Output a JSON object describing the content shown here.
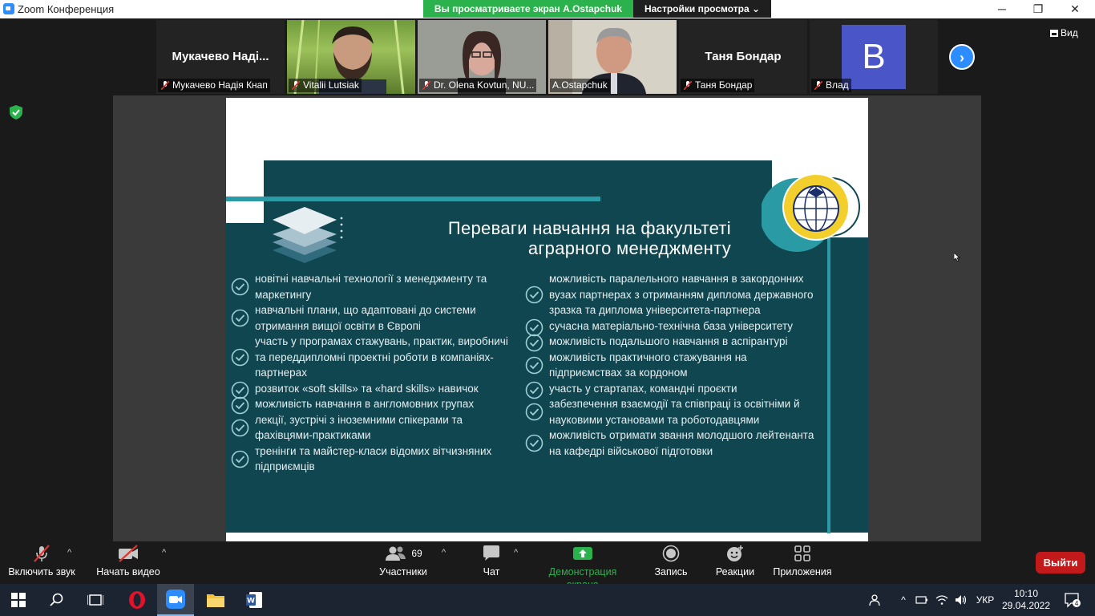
{
  "window": {
    "title": "Zoom Конференция",
    "minimize": "─",
    "restore": "❐",
    "close": "✕"
  },
  "banner": {
    "viewing_text": "Вы просматриваете экран A.Ostapchuk",
    "view_options": "Настройки просмотра ⌄",
    "view_button": "Вид"
  },
  "participants": [
    {
      "big_name": "Мукачево  Наді...",
      "label": "Мукачево Надія Кнап",
      "video": false
    },
    {
      "big_name": "",
      "label": "Vitalii Lutsiak",
      "video": true
    },
    {
      "big_name": "",
      "label": "Dr. Olena Kovtun, NU...",
      "video": true
    },
    {
      "big_name": "",
      "label": "A.Ostapchuk",
      "video": true,
      "active": true
    },
    {
      "big_name": "Таня Бондар",
      "label": "Таня Бондар",
      "video": false
    },
    {
      "big_name": "",
      "label": "Влад",
      "avatar_letter": "B",
      "video": false
    }
  ],
  "slide": {
    "title_line1": "Переваги навчання на факультеті",
    "title_line2": "аграрного менеджменту",
    "left_items": [
      {
        "lines": [
          "новітні навчальні технології з менеджменту та",
          "маркетингу"
        ]
      },
      {
        "lines": [
          "навчальні плани, що адаптовані до системи",
          "отримання вищої освіти в Європі"
        ]
      },
      {
        "lines": [
          "участь у програмах стажувань, практик, виробничі",
          "та переддипломні проектні роботи в компаніях-",
          "партнерах"
        ]
      },
      {
        "lines": [
          "розвиток «soft skills» та «hard skills» навичок"
        ]
      },
      {
        "lines": [
          "можливість навчання в англомовних групах"
        ]
      },
      {
        "lines": [
          "лекції, зустрічі з іноземними спікерами та",
          "фахівцями-практиками"
        ]
      },
      {
        "lines": [
          "тренінги та майстер-класи відомих вітчизняних",
          "підприємців"
        ]
      }
    ],
    "right_items": [
      {
        "lines": [
          "можливість паралельного навчання в закордонних",
          "вузах партнерах з отриманням диплома державного",
          "зразка та диплома університета-партнера"
        ]
      },
      {
        "lines": [
          "сучасна матеріально-технічна база університету"
        ]
      },
      {
        "lines": [
          "можливість подальшого навчання в аспірантурі"
        ]
      },
      {
        "lines": [
          "можливість практичного стажування на",
          "підприємствах за кордоном"
        ]
      },
      {
        "lines": [
          "участь у стартапах, командні проєкти"
        ]
      },
      {
        "lines": [
          "забезпечення взаємодії та співпраці із освітніми й",
          "науковими установами та роботодавцями"
        ]
      },
      {
        "lines": [
          "можливість отримати звання молодшого лейтенанта",
          "на кафедрі військової підготовки"
        ]
      }
    ]
  },
  "toolbar": {
    "unmute": "Включить звук",
    "start_video": "Начать видео",
    "participants": "Участники",
    "participants_count": "69",
    "chat": "Чат",
    "share": "Демонстрация экрана",
    "record": "Запись",
    "reactions": "Реакции",
    "apps": "Приложения",
    "leave": "Выйти"
  },
  "taskbar": {
    "language": "УКР",
    "time": "10:10",
    "date": "29.04.2022",
    "notifications": "4"
  },
  "colors": {
    "slide_panel": "#0f4650",
    "slide_accent": "#2a9ba5",
    "share_green": "#2bb24c",
    "leave_red": "#c21a1a",
    "zoom_blue": "#2d8cff"
  }
}
